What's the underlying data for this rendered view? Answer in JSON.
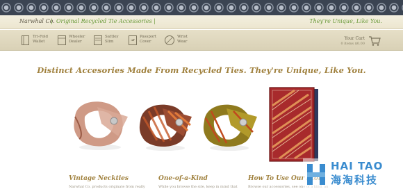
{
  "brand": {
    "name": "Narwhal Co.",
    "separator": "|",
    "tagline": "Original Recycled Tie Accessories |",
    "slogan": "They're Unique, Like You."
  },
  "nav": {
    "items": [
      {
        "line1": "Tri-Fold",
        "line2": "Wallet",
        "icon": "wallet-icon"
      },
      {
        "line1": "Wheeler",
        "line2": "Dealer",
        "icon": "wallet-icon"
      },
      {
        "line1": "Sattley",
        "line2": "Slim",
        "icon": "slim-wallet-icon"
      },
      {
        "line1": "Passport",
        "line2": "Cover",
        "icon": "passport-icon"
      },
      {
        "line1": "Wrist",
        "line2": "Wear",
        "icon": "bracelet-icon"
      }
    ],
    "cart_label": "Your Cart",
    "cart_total": "0 items  $0.00"
  },
  "hero": {
    "headline": "Distinct Accesories Made From Recycled Ties. They're Unique, Like You."
  },
  "sections": [
    {
      "title": "Vintage Neckties",
      "text": "Narwhal Co. products originate from really"
    },
    {
      "title": "One-of-a-Kind",
      "text": "While you browse the site, keep in mind that"
    },
    {
      "title": "How To Use Our Store",
      "text": "Browse our accessories, see one of a kind, an"
    }
  ],
  "watermark": {
    "title": "HAI TAO",
    "subtitle": "海淘科技"
  },
  "colors": {
    "accent_gold": "#a0813e",
    "accent_green": "#6a9a3a",
    "nav_bg": "#e6dfc7",
    "pattern_navy": "#3b4452"
  }
}
